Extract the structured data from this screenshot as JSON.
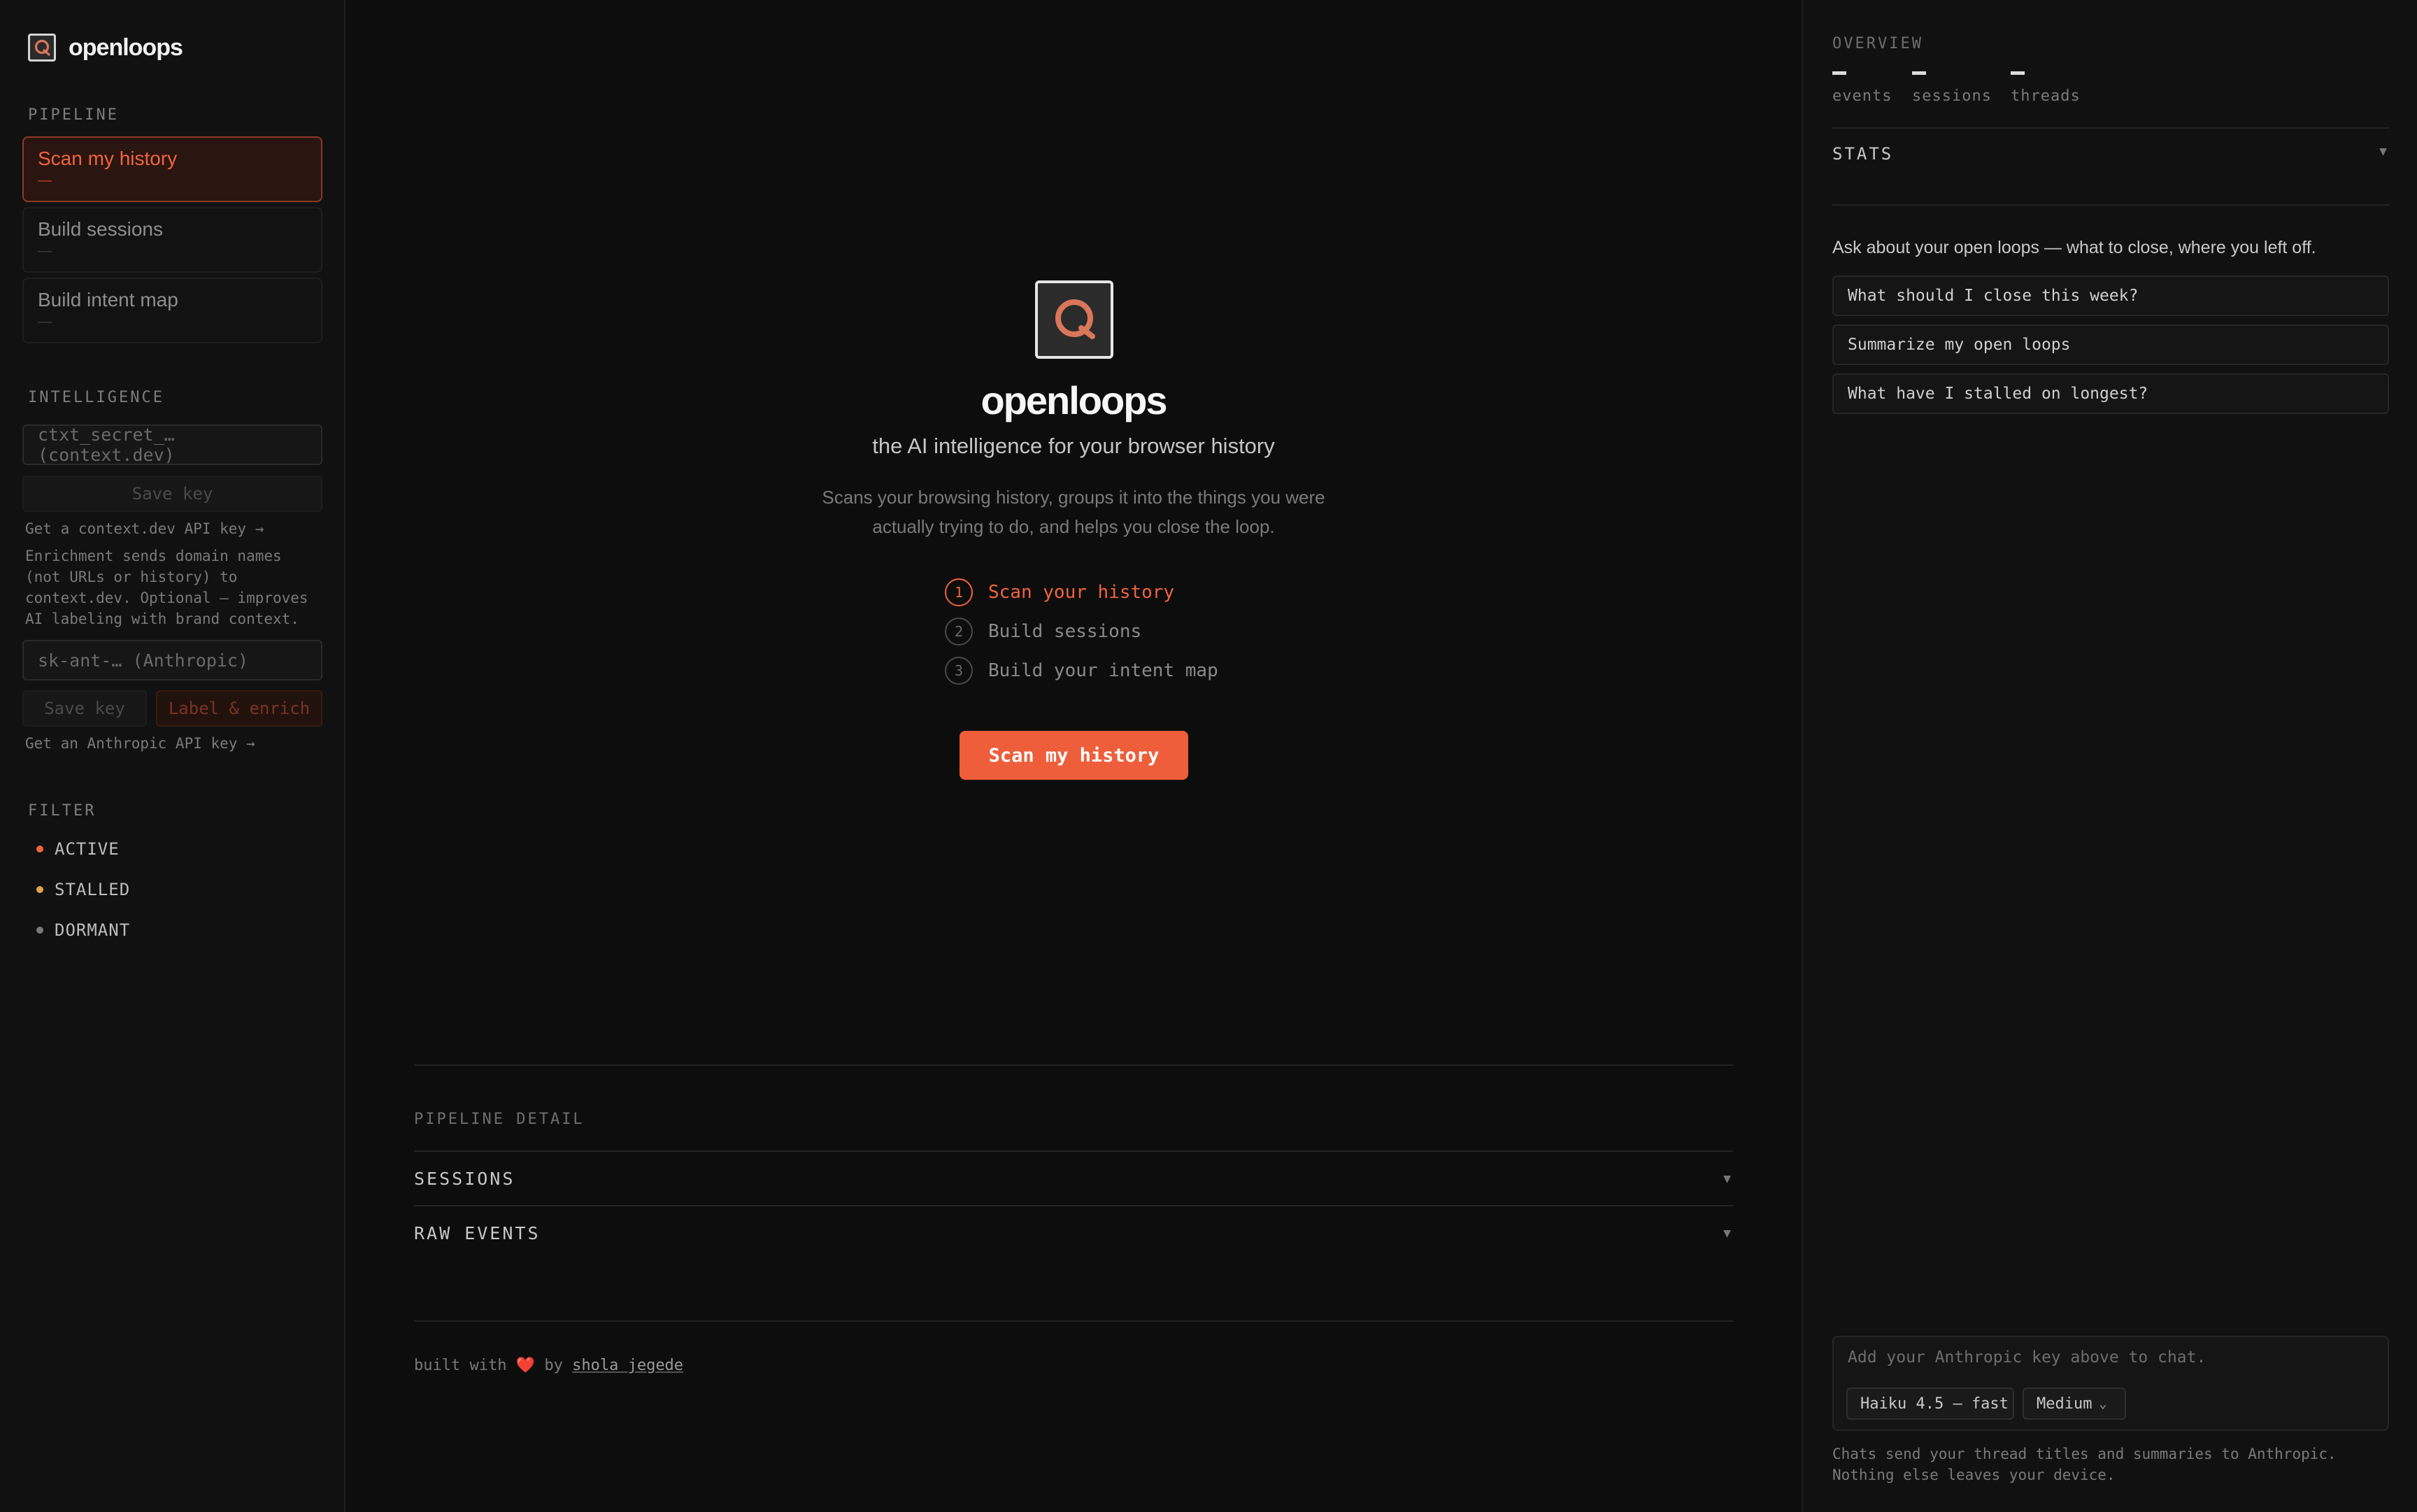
{
  "app": {
    "name": "openloops"
  },
  "sidebar": {
    "pipeline_label": "PIPELINE",
    "steps": [
      {
        "title": "Scan my history",
        "sub": "—"
      },
      {
        "title": "Build sessions",
        "sub": "—"
      },
      {
        "title": "Build intent map",
        "sub": "—"
      }
    ],
    "intelligence_label": "INTELLIGENCE",
    "context_key_placeholder": "ctxt_secret_… (context.dev)",
    "save_key_label": "Save key",
    "context_link": "Get a context.dev API key →",
    "enrich_note": "Enrichment sends domain names (not URLs or history) to context.dev. Optional — improves AI labeling with brand context.",
    "anthropic_key_placeholder": "sk-ant-… (Anthropic)",
    "label_enrich_label": "Label & enrich",
    "anthropic_link": "Get an Anthropic API key →",
    "filter_label": "FILTER",
    "filters": [
      {
        "label": "ACTIVE",
        "color": "#f0643e"
      },
      {
        "label": "STALLED",
        "color": "#e0a24a"
      },
      {
        "label": "DORMANT",
        "color": "#7a7a7a"
      }
    ]
  },
  "main": {
    "title": "openloops",
    "subtitle": "the AI intelligence for your browser history",
    "description": "Scans your browsing history, groups it into the things you were actually trying to do, and helps you close the loop.",
    "steps": [
      {
        "num": "1",
        "label": "Scan your history"
      },
      {
        "num": "2",
        "label": "Build sessions"
      },
      {
        "num": "3",
        "label": "Build your intent map"
      }
    ],
    "cta_label": "Scan my history",
    "pipeline_detail_label": "PIPELINE DETAIL",
    "accordions": [
      {
        "label": "SESSIONS"
      },
      {
        "label": "RAW EVENTS"
      }
    ],
    "footer": {
      "prefix": "built with",
      "heart": "❤️",
      "by": "by",
      "author": "shola jegede"
    }
  },
  "right": {
    "overview_label": "OVERVIEW",
    "stats": [
      {
        "value": "—",
        "label": "events"
      },
      {
        "value": "—",
        "label": "sessions"
      },
      {
        "value": "—",
        "label": "threads"
      }
    ],
    "stats_label": "STATS",
    "ask_text": "Ask about your open loops — what to close, where you left off.",
    "suggestions": [
      "What should I close this week?",
      "Summarize my open loops",
      "What have I stalled on longest?"
    ],
    "chat_placeholder": "Add your Anthropic key above to chat.",
    "model_select": "Haiku 4.5 — fast",
    "effort_select": "Medium",
    "chat_note": "Chats send your thread titles and summaries to Anthropic. Nothing else leaves your device."
  },
  "colors": {
    "accent": "#ee5e3b",
    "background": "#0d0d0d",
    "panel": "#111111"
  }
}
